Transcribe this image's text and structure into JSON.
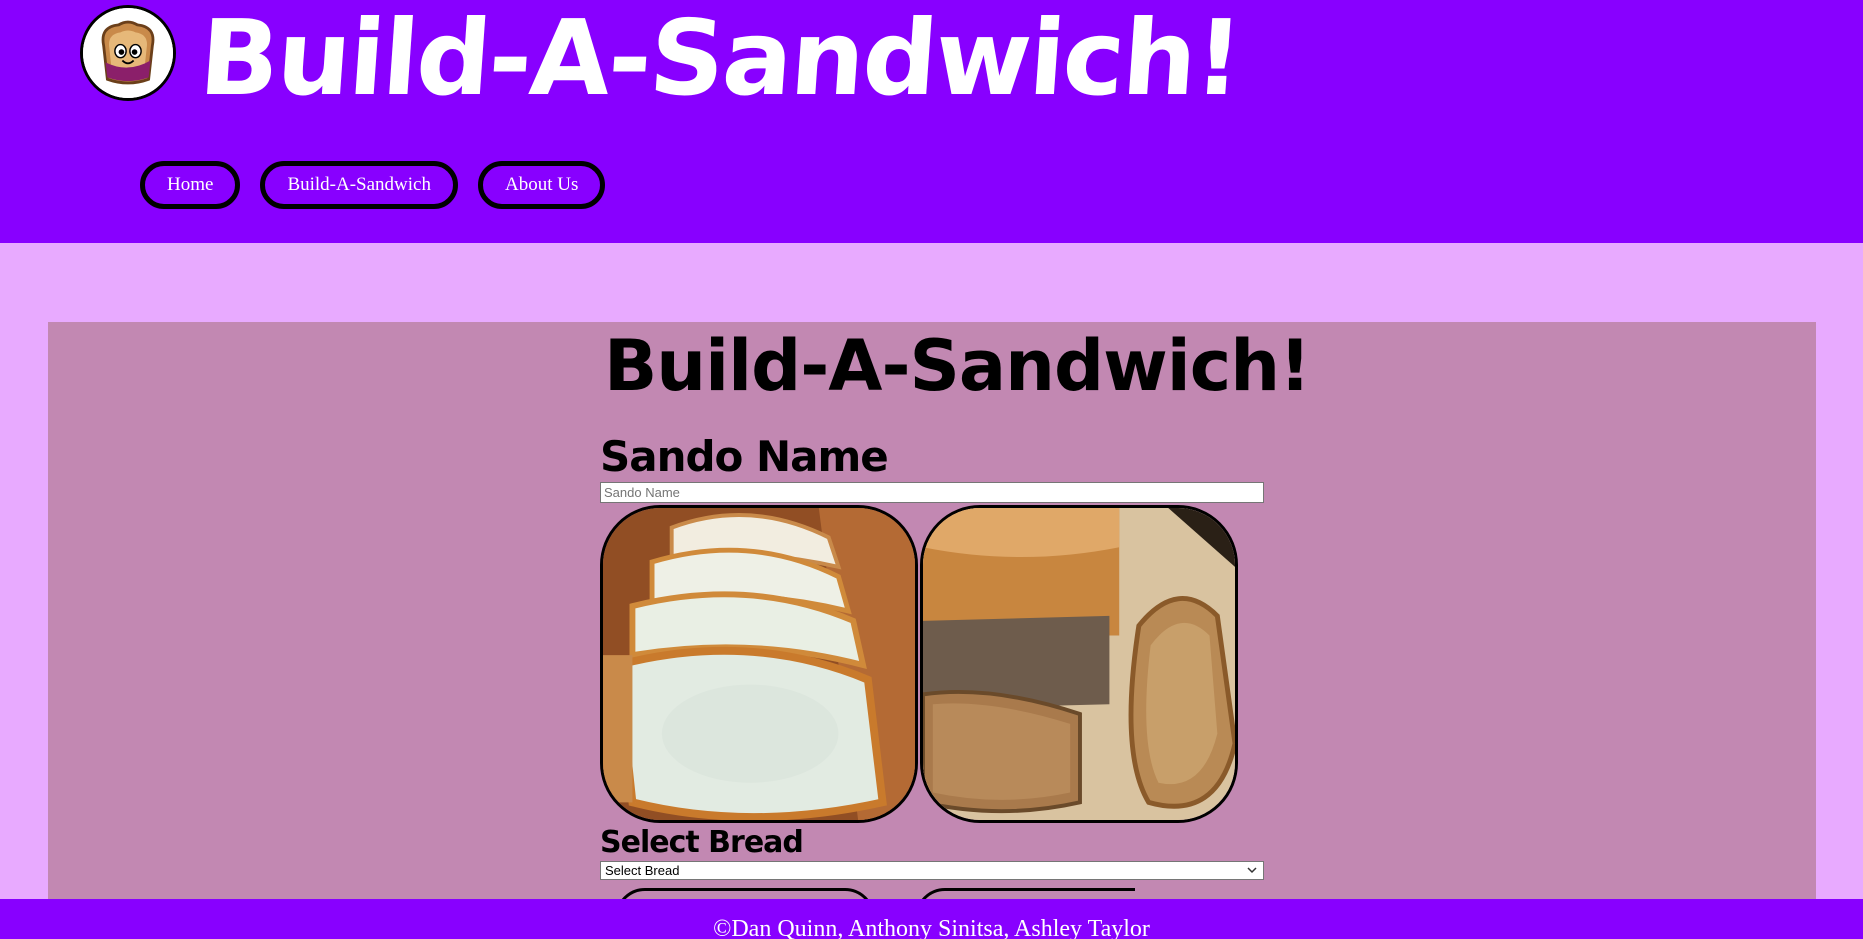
{
  "header": {
    "title": "Build-A-Sandwich!",
    "logo_icon": "toast-mascot-icon",
    "background": "#8800ff"
  },
  "nav": {
    "items": [
      {
        "label": "Home"
      },
      {
        "label": "Build-A-Sandwich"
      },
      {
        "label": "About Us"
      }
    ]
  },
  "main": {
    "heading": "Build-A-Sandwich!",
    "sando_name_label": "Sando Name",
    "sando_name_placeholder": "Sando Name",
    "sando_name_value": "",
    "bread_images": [
      {
        "icon": "white-bread-slices-image"
      },
      {
        "icon": "wheat-bread-loaf-image"
      }
    ],
    "select_bread_label": "Select Bread",
    "select_bread_value": "Select Bread"
  },
  "footer": {
    "text": "©Dan Quinn, Anthony Sinitsa, Ashley Taylor"
  },
  "colors": {
    "page_bg": "#e8aaff",
    "panel_bg": "#c288b2",
    "accent": "#8800ff"
  }
}
